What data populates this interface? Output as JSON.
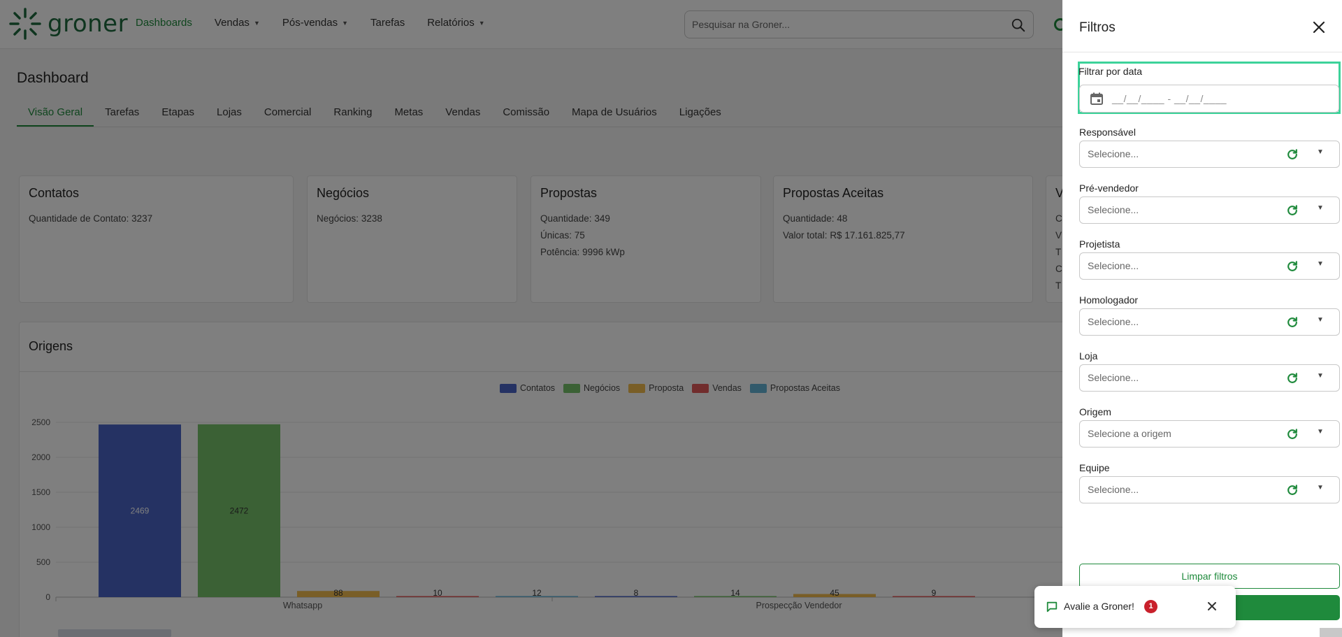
{
  "nav": {
    "logo_text": "groner",
    "items": [
      {
        "label": "Dashboards",
        "active": true,
        "caret": false
      },
      {
        "label": "Vendas",
        "active": false,
        "caret": true
      },
      {
        "label": "Pós-vendas",
        "active": false,
        "caret": true
      },
      {
        "label": "Tarefas",
        "active": false,
        "caret": false
      },
      {
        "label": "Relatórios",
        "active": false,
        "caret": true
      }
    ],
    "search_placeholder": "Pesquisar na Groner..."
  },
  "page": {
    "title": "Dashboard",
    "tabs": [
      "Visão Geral",
      "Tarefas",
      "Etapas",
      "Lojas",
      "Comercial",
      "Ranking",
      "Metas",
      "Vendas",
      "Comissão",
      "Mapa de Usuários",
      "Ligações"
    ],
    "active_tab": "Visão Geral"
  },
  "cards": {
    "contatos": {
      "title": "Contatos",
      "l1": "Quantidade de Contato:",
      "v1": "3237"
    },
    "negocios": {
      "title": "Negócios",
      "l1": "Negócios:",
      "v1": "3238"
    },
    "propostas": {
      "title": "Propostas",
      "l1": "Quantidade:",
      "v1": "349",
      "l2": "Únicas:",
      "v2": "75",
      "l3": "Potência:",
      "v3": "9996 kWp"
    },
    "aceitas": {
      "title": "Propostas Aceitas",
      "l1": "Quantidade:",
      "v1": "48",
      "l2": "Valor total:",
      "v2": "R$ 17.161.825,77"
    },
    "partial": {
      "title": "V",
      "letters": [
        "C",
        "V",
        "T",
        "C",
        "T"
      ]
    }
  },
  "origens": {
    "title": "Origens"
  },
  "chart_data": {
    "type": "bar",
    "categories": [
      "Whatsapp",
      "Prospecção Vendedor"
    ],
    "series": [
      {
        "name": "Contatos",
        "color": "#4a64c7",
        "values": [
          2469,
          8
        ]
      },
      {
        "name": "Negócios",
        "color": "#77c26a",
        "values": [
          2472,
          14
        ]
      },
      {
        "name": "Proposta",
        "color": "#f2bc4f",
        "values": [
          88,
          45
        ]
      },
      {
        "name": "Vendas",
        "color": "#e35a5a",
        "values": [
          10,
          9
        ]
      },
      {
        "name": "Propostas Aceitas",
        "color": "#65b4d6",
        "values": [
          12,
          null
        ]
      }
    ],
    "y_ticks": [
      "0",
      "500",
      "1000",
      "1500",
      "2000",
      "2500"
    ],
    "ylim": [
      0,
      2500
    ],
    "legend_position": "top",
    "grid": true
  },
  "filters": {
    "title": "Filtros",
    "date_label": "Filtrar por data",
    "date_mask": "__/__/____ - __/__/____",
    "fields": [
      {
        "label": "Responsável",
        "placeholder": "Selecione..."
      },
      {
        "label": "Pré-vendedor",
        "placeholder": "Selecione..."
      },
      {
        "label": "Projetista",
        "placeholder": "Selecione..."
      },
      {
        "label": "Homologador",
        "placeholder": "Selecione..."
      },
      {
        "label": "Loja",
        "placeholder": "Selecione..."
      },
      {
        "label": "Origem",
        "placeholder": "Selecione a origem"
      },
      {
        "label": "Equipe",
        "placeholder": "Selecione..."
      }
    ],
    "clear_label": "Limpar filtros"
  },
  "toast": {
    "text": "Avalie a Groner!",
    "badge": "1"
  }
}
